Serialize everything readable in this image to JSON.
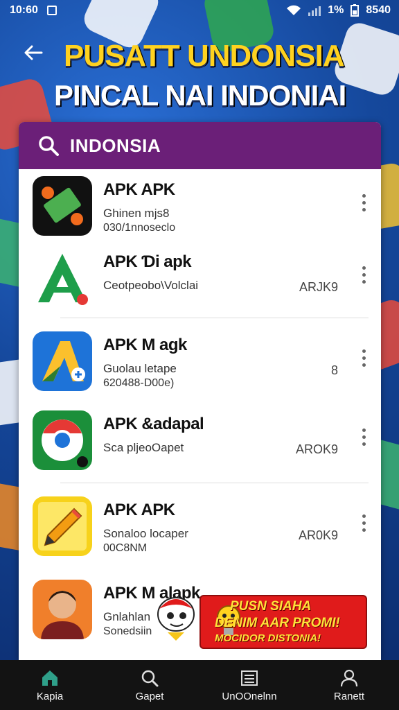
{
  "status_bar": {
    "time": "10:60",
    "battery_pct": "1%",
    "right_text": "8540"
  },
  "header": {
    "hero_line1": "PUSATT UNDONSIA",
    "hero_line2": "PINCAL NAI INDONIAI"
  },
  "search": {
    "query": "INDONSIA"
  },
  "apps": [
    {
      "title": "APK APK",
      "sub1": "Ghinen mjs8",
      "sub2": "030/1nnoseclo",
      "meta": ""
    },
    {
      "title": "APK Ɗi apk",
      "sub1": "Ceotpeobo\\Volclai",
      "sub2": "",
      "meta": "ARJK9"
    },
    {
      "title": "APK M agk",
      "sub1": "Guolau letape",
      "sub2": "620488-D00e)",
      "meta": "8"
    },
    {
      "title": "APK &adapal",
      "sub1": "Sca pljeoOapet",
      "sub2": "",
      "meta": "AROK9"
    },
    {
      "title": "APK APK",
      "sub1": "Sonaloo locaper",
      "sub2": "00C8NM",
      "meta": "AR0K9"
    },
    {
      "title": "APK M alapk",
      "sub1": "Gnlahlan",
      "sub2": "Sonedsiin",
      "meta": ""
    }
  ],
  "promo": {
    "line1": "PUSN SIAHA",
    "line2": "DENIM AAR PROMI!",
    "line3": "MOCIDOR DISTONIA!"
  },
  "nav": [
    {
      "label": "Kapia",
      "icon": "home-icon"
    },
    {
      "label": "Gapet",
      "icon": "search-icon"
    },
    {
      "label": "UnOOnelnn",
      "icon": "list-icon"
    },
    {
      "label": "Ranett",
      "icon": "profile-icon"
    }
  ],
  "colors": {
    "search_bar": "#6b1f78",
    "hero_yellow": "#ffd21f",
    "promo_red": "#e01b1b",
    "nav_bg": "#131313"
  }
}
